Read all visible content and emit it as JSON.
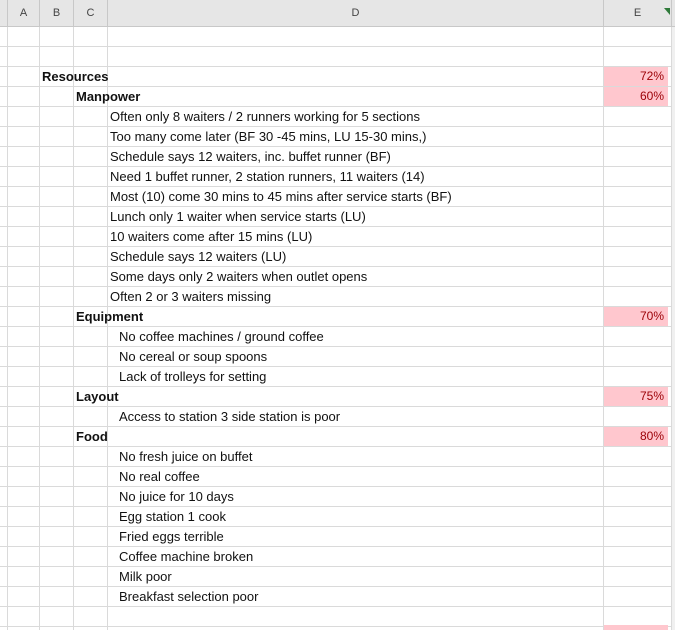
{
  "columns": [
    "A",
    "B",
    "C",
    "D",
    "E"
  ],
  "rows": [
    {
      "text": "",
      "level": 0,
      "pct": null
    },
    {
      "text": "",
      "level": 0,
      "pct": null
    },
    {
      "text": "Resources",
      "level": 1,
      "bold": true,
      "pct": "72%"
    },
    {
      "text": "Manpower",
      "level": 2,
      "bold": true,
      "pct": "60%"
    },
    {
      "text": "Often only 8 waiters / 2 runners working for 5 sections",
      "level": 3,
      "pct": null
    },
    {
      "text": "Too many come later (BF 30 -45 mins, LU 15-30 mins,)",
      "level": 3,
      "pct": null
    },
    {
      "text": "Schedule says 12 waiters, inc. buffet runner (BF)",
      "level": 3,
      "pct": null
    },
    {
      "text": "Need 1 buffet runner, 2 station runners, 11 waiters (14)",
      "level": 3,
      "pct": null
    },
    {
      "text": "Most (10) come 30 mins to 45 mins after service starts (BF)",
      "level": 3,
      "pct": null
    },
    {
      "text": "Lunch only 1 waiter when service starts (LU)",
      "level": 3,
      "pct": null
    },
    {
      "text": "10 waiters come after 15 mins (LU)",
      "level": 3,
      "pct": null
    },
    {
      "text": "Schedule says 12 waiters (LU)",
      "level": 3,
      "pct": null
    },
    {
      "text": "Some days only 2 waiters when outlet opens",
      "level": 3,
      "pct": null
    },
    {
      "text": "Often 2 or 3 waiters missing",
      "level": 3,
      "pct": null
    },
    {
      "text": "Equipment",
      "level": 2,
      "bold": true,
      "pct": "70%"
    },
    {
      "text": "No coffee machines / ground coffee",
      "level": 4,
      "pct": null
    },
    {
      "text": "No cereal or soup spoons",
      "level": 4,
      "pct": null
    },
    {
      "text": "Lack of trolleys for setting",
      "level": 4,
      "pct": null
    },
    {
      "text": "Layout",
      "level": 2,
      "bold": true,
      "pct": "75%"
    },
    {
      "text": "Access to station 3 side station is poor",
      "level": 4,
      "pct": null
    },
    {
      "text": "Food",
      "level": 2,
      "bold": true,
      "pct": "80%"
    },
    {
      "text": "No fresh juice on buffet",
      "level": 4,
      "pct": null
    },
    {
      "text": "No real coffee",
      "level": 4,
      "pct": null
    },
    {
      "text": "No juice for 10 days",
      "level": 4,
      "pct": null
    },
    {
      "text": "Egg station 1 cook",
      "level": 4,
      "pct": null
    },
    {
      "text": "Fried eggs terrible",
      "level": 4,
      "pct": null
    },
    {
      "text": "Coffee machine broken",
      "level": 4,
      "pct": null
    },
    {
      "text": "Milk poor",
      "level": 4,
      "pct": null
    },
    {
      "text": "Breakfast selection poor",
      "level": 4,
      "pct": null
    },
    {
      "text": "",
      "level": 0,
      "pct": null
    }
  ],
  "colors": {
    "highlight_fill": "#ffc7ce",
    "highlight_text": "#9c0006",
    "header_bg": "#e6e6e6"
  }
}
